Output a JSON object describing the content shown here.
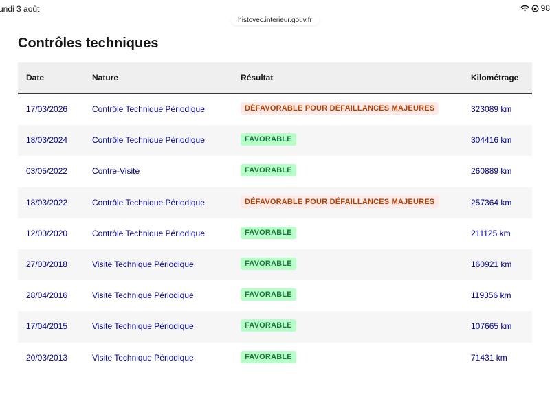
{
  "statusbar": {
    "date": "undi 3 août",
    "battery_text": "98"
  },
  "browser": {
    "url": "histovec.interieur.gouv.fr"
  },
  "page": {
    "title": "Contrôles techniques"
  },
  "table": {
    "headers": {
      "date": "Date",
      "nature": "Nature",
      "result": "Résultat",
      "mileage": "Kilométrage"
    },
    "rows": [
      {
        "date": "17/03/2026",
        "nature": "Contrôle Technique Périodique",
        "result": "DÉFAVORABLE POUR DÉFAILLANCES MAJEURES",
        "result_type": "defavorable",
        "mileage": "323089 km"
      },
      {
        "date": "18/03/2024",
        "nature": "Contrôle Technique Périodique",
        "result": "FAVORABLE",
        "result_type": "favorable",
        "mileage": "304416 km"
      },
      {
        "date": "03/05/2022",
        "nature": "Contre-Visite",
        "result": "FAVORABLE",
        "result_type": "favorable",
        "mileage": "260889 km"
      },
      {
        "date": "18/03/2022",
        "nature": "Contrôle Technique Périodique",
        "result": "DÉFAVORABLE POUR DÉFAILLANCES MAJEURES",
        "result_type": "defavorable",
        "mileage": "257364 km"
      },
      {
        "date": "12/03/2020",
        "nature": "Contrôle Technique Périodique",
        "result": "FAVORABLE",
        "result_type": "favorable",
        "mileage": "211125 km"
      },
      {
        "date": "27/03/2018",
        "nature": "Visite Technique Périodique",
        "result": "FAVORABLE",
        "result_type": "favorable",
        "mileage": "160921 km"
      },
      {
        "date": "28/04/2016",
        "nature": "Visite Technique Périodique",
        "result": "FAVORABLE",
        "result_type": "favorable",
        "mileage": "119356 km"
      },
      {
        "date": "17/04/2015",
        "nature": "Visite Technique Périodique",
        "result": "FAVORABLE",
        "result_type": "favorable",
        "mileage": "107665 km"
      },
      {
        "date": "20/03/2013",
        "nature": "Visite Technique Périodique",
        "result": "FAVORABLE",
        "result_type": "favorable",
        "mileage": "71431 km"
      }
    ]
  },
  "colors": {
    "link_blue": "#000091",
    "favorable_bg": "#b8fec9",
    "favorable_text": "#18753c",
    "defavorable_bg": "#ffe9e6",
    "defavorable_text": "#b34000"
  }
}
